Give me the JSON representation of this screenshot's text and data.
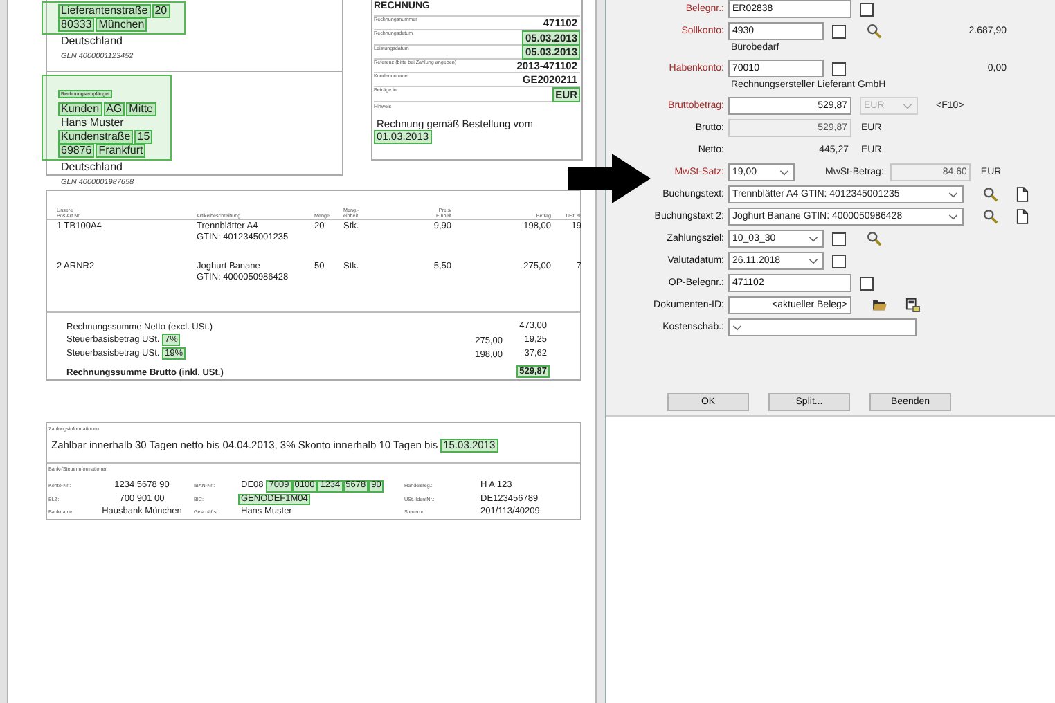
{
  "invoice": {
    "seller": {
      "block": {
        "highlighted": true,
        "lines": [
          [
            {
              "text": "Lieferantenstraße",
              "highlighted": true
            },
            {
              "text": "20",
              "highlighted": true
            }
          ],
          [
            {
              "text": "80333",
              "highlighted": true
            },
            {
              "text": "München",
              "highlighted": true
            }
          ]
        ]
      },
      "country": "Deutschland",
      "gln": "GLN 4000001123452"
    },
    "recipient": {
      "block": {
        "highlighted": true,
        "label": {
          "text": "Rechnungsempfänger",
          "highlighted": true
        },
        "lines": [
          [
            {
              "text": "Kunden",
              "highlighted": true
            },
            {
              "text": "AG",
              "highlighted": true
            },
            {
              "text": "Mitte",
              "highlighted": true
            }
          ],
          [
            {
              "text": "Hans Muster",
              "highlighted": false
            }
          ],
          [
            {
              "text": "Kundenstraße",
              "highlighted": true
            },
            {
              "text": "15",
              "highlighted": true
            }
          ],
          [
            {
              "text": "69876",
              "highlighted": true
            },
            {
              "text": "Frankfurt",
              "highlighted": true
            }
          ]
        ]
      },
      "country": "Deutschland",
      "gln": "GLN 4000001987658"
    },
    "header": {
      "title": "RECHNUNG",
      "rows": [
        {
          "label": "Rechnungsnummer",
          "value": {
            "text": "471102",
            "highlighted": false
          }
        },
        {
          "label": "Rechnungsdatum",
          "value": {
            "text": "05.03.2013",
            "highlighted": true
          }
        },
        {
          "label": "Leistungsdatum",
          "value": {
            "text": "05.03.2013",
            "highlighted": true
          }
        },
        {
          "label": "Referenz (bitte bei Zahlung angeben)",
          "value": {
            "text": "2013-471102",
            "highlighted": false
          }
        },
        {
          "label": "Kundennummer",
          "value": {
            "text": "GE2020211",
            "highlighted": false
          }
        },
        {
          "label": "Beträge in",
          "value": {
            "text": "EUR",
            "highlighted": true
          }
        }
      ],
      "note_label": "Hinweis",
      "note": [
        {
          "text": "Rechnung gemäß Bestellung vom",
          "highlighted": false
        },
        {
          "text": "01.03.2013",
          "highlighted": true
        }
      ]
    },
    "items": {
      "columns": [
        [
          "Unsere",
          "Pos Art.Nr"
        ],
        [
          "Artikelbeschreibung"
        ],
        [
          "Menge"
        ],
        [
          "Meng.-",
          "einheit"
        ],
        [
          "Preis/",
          "Einheit"
        ],
        [
          "Betrag"
        ],
        [
          "USt. %"
        ]
      ],
      "rows": [
        {
          "pos": "1 TB100A4",
          "description": [
            "Trennblätter A4",
            "GTIN: 4012345001235"
          ],
          "quantity": "20",
          "unit": "Stk.",
          "price": "9,90",
          "amount": "198,00",
          "vat": "19"
        },
        {
          "pos": "2 ARNR2",
          "description": [
            "Joghurt Banane",
            "GTIN: 4000050986428"
          ],
          "quantity": "50",
          "unit": "Stk.",
          "price": "5,50",
          "amount": "275,00",
          "vat": "7"
        }
      ]
    },
    "totals": [
      {
        "kind": "sum",
        "label": "Rechnungssumme Netto (excl. USt.)",
        "amount": {
          "text": "473,00",
          "highlighted": false
        }
      },
      {
        "kind": "tax",
        "label": "Steuerbasisbetrag USt.",
        "rate": {
          "text": "7%",
          "highlighted": true
        },
        "base": "275,00",
        "amount": {
          "text": "19,25",
          "highlighted": false
        }
      },
      {
        "kind": "tax",
        "label": "Steuerbasisbetrag USt.",
        "rate": {
          "text": "19%",
          "highlighted": true
        },
        "base": "198,00",
        "amount": {
          "text": "37,62",
          "highlighted": false
        }
      },
      {
        "kind": "total",
        "label": "Rechnungssumme Brutto (inkl. USt.)",
        "amount": {
          "text": "529,87",
          "highlighted": true
        }
      }
    ],
    "payment": {
      "label": "Zahlungsinformationen",
      "text": [
        {
          "text": "Zahlbar innerhalb 30 Tagen netto bis 04.04.2013, 3% Skonto innerhalb 10 Tagen bis",
          "highlighted": false
        },
        {
          "text": "15.03.2013",
          "highlighted": true
        }
      ]
    },
    "bank": {
      "label": "Bank-/Steuerinformationen",
      "rows": [
        [
          {
            "label": "Konto-Nr.:",
            "value": [
              {
                "text": "1234 5678 90",
                "highlighted": false
              }
            ]
          },
          {
            "label": "IBAN-Nr.:",
            "value": [
              {
                "text": "DE08",
                "highlighted": false
              },
              {
                "text": "7009",
                "highlighted": true
              },
              {
                "text": "0100",
                "highlighted": true
              },
              {
                "text": "1234",
                "highlighted": true
              },
              {
                "text": "5678",
                "highlighted": true
              },
              {
                "text": "90",
                "highlighted": true
              }
            ]
          },
          {
            "label": "Handelsreg.:",
            "value": [
              {
                "text": "H A 123",
                "highlighted": false
              }
            ]
          }
        ],
        [
          {
            "label": "BLZ:",
            "value": [
              {
                "text": "700 901 00",
                "highlighted": false
              }
            ]
          },
          {
            "label": "BIC:",
            "value": [
              {
                "text": "GENODEF1M04",
                "highlighted": true
              }
            ]
          },
          {
            "label": "USt.-IdentNr.:",
            "value": [
              {
                "text": "DE123456789",
                "highlighted": false
              }
            ]
          }
        ],
        [
          {
            "label": "Bankname:",
            "value": [
              {
                "text": "Hausbank München",
                "highlighted": false
              }
            ]
          },
          {
            "label": "Geschäftsf.:",
            "value": [
              {
                "text": "Hans Muster",
                "highlighted": false
              }
            ]
          },
          {
            "label": "Steuernr.:",
            "value": [
              {
                "text": "201/113/40209",
                "highlighted": false
              }
            ]
          }
        ]
      ]
    }
  },
  "dialog": {
    "rows": [
      {
        "label": "Belegnr.:",
        "required": true,
        "field": {
          "kind": "input",
          "value": "ER02838"
        },
        "checked": false
      },
      {
        "label": "Sollkonto:",
        "required": true,
        "field": {
          "kind": "input",
          "value": "4930"
        },
        "checked": false,
        "actions": {
          "lookup": true
        },
        "amount": "2.687,90",
        "note": "Bürobedarf"
      },
      {
        "label": "Habenkonto:",
        "required": true,
        "field": {
          "kind": "input",
          "value": "70010"
        },
        "checked": false,
        "amount": "0,00",
        "note": "Rechnungsersteller Lieferant GmbH"
      },
      {
        "label": "Bruttobetrag:",
        "required": true,
        "field": {
          "kind": "input",
          "value": "529,87"
        },
        "currency": {
          "value": "EUR",
          "disabled": true
        },
        "hint": "<F10>"
      },
      {
        "label": "Brutto:",
        "required": false,
        "field": {
          "kind": "readonly",
          "value": "529,87"
        },
        "unit": "EUR"
      },
      {
        "label": "Netto:",
        "required": false,
        "field": {
          "kind": "plain",
          "value": "445,27"
        },
        "unit": "EUR"
      },
      {
        "label": "MwSt-Satz:",
        "required": true,
        "field": {
          "kind": "combo",
          "value": "19,00"
        },
        "tax": {
          "label": "MwSt-Betrag:",
          "value": "84,60",
          "unit": "EUR"
        }
      },
      {
        "label": "Buchungstext:",
        "required": false,
        "field": {
          "kind": "combo",
          "value": "Trennblätter A4 GTIN: 4012345001235"
        },
        "actions": {
          "lookup": true,
          "new": true
        }
      },
      {
        "label": "Buchungstext 2:",
        "required": false,
        "field": {
          "kind": "combo",
          "value": "Joghurt Banane GTIN: 4000050986428"
        },
        "actions": {
          "lookup": true,
          "new": true
        }
      },
      {
        "label": "Zahlungsziel:",
        "required": false,
        "field": {
          "kind": "combo",
          "value": "10_03_30"
        },
        "checked": false,
        "actions": {
          "lookup": true
        }
      },
      {
        "label": "Valutadatum:",
        "required": false,
        "field": {
          "kind": "combo",
          "value": "26.11.2018"
        },
        "checked": false
      },
      {
        "label": "OP-Belegnr.:",
        "required": false,
        "field": {
          "kind": "input",
          "value": "471102"
        },
        "checked": false
      },
      {
        "label": "Dokumenten-ID:",
        "required": false,
        "field": {
          "kind": "input",
          "value": "<aktueller Beleg>"
        },
        "actions": {
          "open": true,
          "scan": true
        }
      },
      {
        "label": "Kostenschab.:",
        "required": false,
        "field": {
          "kind": "combo"
        }
      }
    ],
    "buttons": [
      "OK",
      "Split...",
      "Beenden"
    ]
  }
}
